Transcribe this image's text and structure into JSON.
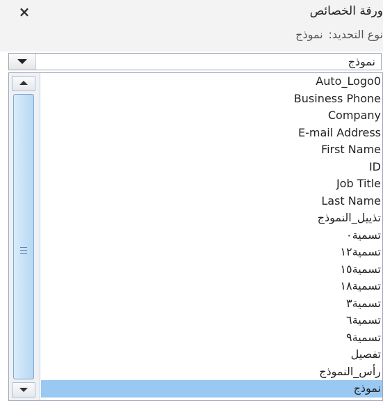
{
  "window": {
    "title": "ورقة الخصائص",
    "close_icon": "×"
  },
  "selection": {
    "label": "نوع التحديد:",
    "value": "نموذج"
  },
  "combo": {
    "value": "نموذج"
  },
  "list": {
    "items": [
      "Auto_Logo0",
      "Business Phone",
      "Company",
      "E-mail Address",
      "First Name",
      "ID",
      "Job Title",
      "Last Name",
      "تذييل_النموذج",
      "تسمية٠",
      "تسمية١٢",
      "تسمية١٥",
      "تسمية١٨",
      "تسمية٣",
      "تسمية٦",
      "تسمية٩",
      "تفصيل",
      "رأس_النموذج",
      "نموذج"
    ],
    "selected_index": 18
  },
  "colors": {
    "selection_highlight": "#99c8f2",
    "panel_background": "#f3f3f3"
  }
}
